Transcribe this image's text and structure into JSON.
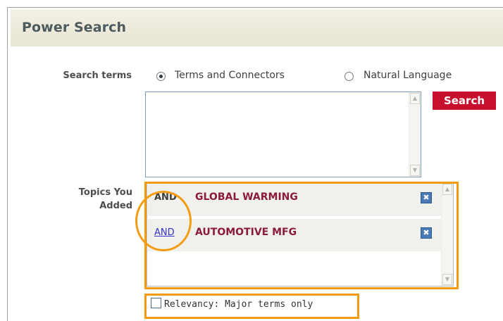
{
  "page_title": "Power Search",
  "search_terms": {
    "label": "Search terms",
    "options": [
      {
        "label": "Terms and Connectors",
        "selected": true
      },
      {
        "label": "Natural Language",
        "selected": false
      }
    ],
    "query_value": "",
    "search_button_label": "Search"
  },
  "topics": {
    "label_line1": "Topics You",
    "label_line2": "Added",
    "items": [
      {
        "connector": "AND",
        "connector_is_link": false,
        "name": "GLOBAL WARMING"
      },
      {
        "connector": "AND",
        "connector_is_link": true,
        "name": "AUTOMOTIVE MFG"
      }
    ]
  },
  "relevancy": {
    "label": "Relevancy: Major terms only",
    "checked": false
  },
  "colors": {
    "header_bg": "#ece9d8",
    "search_button": "#c8102e",
    "topic_text": "#8b1a3c",
    "highlight": "#f39c12",
    "link": "#3333cc"
  },
  "icons": {
    "remove": "close-x-icon",
    "scroll_up": "chevron-up-icon",
    "scroll_down": "chevron-down-icon"
  }
}
